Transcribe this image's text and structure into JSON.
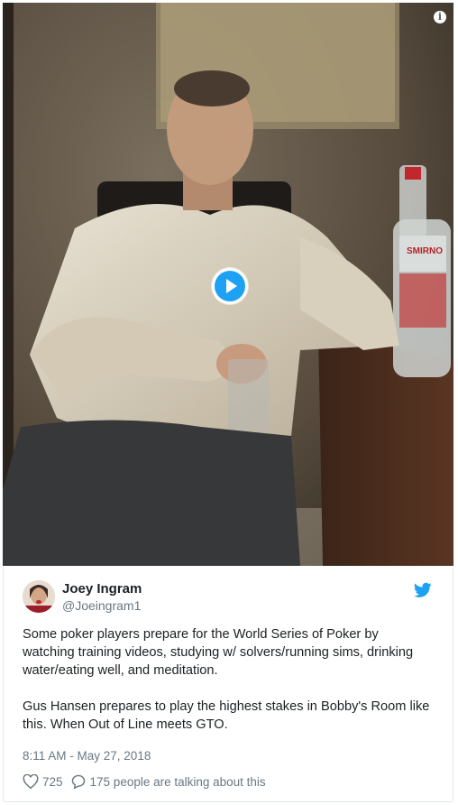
{
  "tweet": {
    "author_name": "Joey Ingram",
    "author_handle": "@Joeingram1",
    "text_p1": "Some poker players prepare for the World Series of Poker by watching training videos, studying w/ solvers/running sims, drinking water/eating well, and meditation.",
    "text_p2": "Gus Hansen prepares to play the highest stakes in Bobby's Room like this. When Out of Line meets GTO.",
    "timestamp": "8:11 AM - May 27, 2018",
    "likes": "725",
    "talking": "175 people are talking about this"
  },
  "media": {
    "bottle_label": "SMIRNO",
    "info_label": "i"
  },
  "icons": {
    "play": "play-icon",
    "info": "info-icon",
    "bird": "twitter-bird-icon",
    "heart": "heart-icon",
    "reply": "reply-icon"
  },
  "colors": {
    "accent": "#1da1f2",
    "secondary_text": "#697882",
    "primary_text": "#1c2022"
  }
}
